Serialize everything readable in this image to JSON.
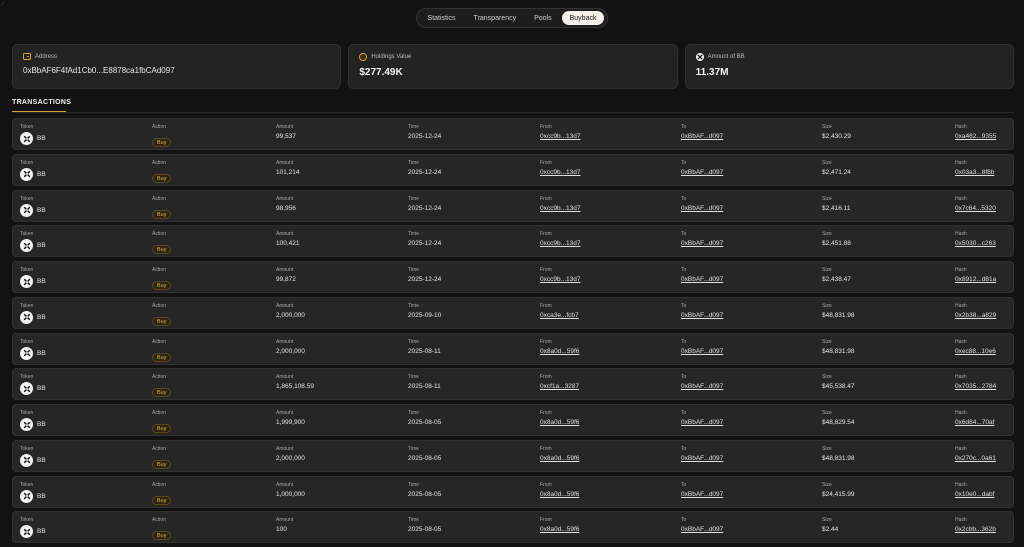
{
  "corner_mark": "⁄",
  "nav": {
    "tabs": [
      {
        "label": "Statistics"
      },
      {
        "label": "Transparency"
      },
      {
        "label": "Pools"
      },
      {
        "label": "Buyback",
        "active": true
      }
    ]
  },
  "cards": {
    "address": {
      "title": "Address",
      "value": "0xBbAF6F4fAd1Cb0...E8878ca1fbCAd097",
      "icon": "wallet-icon"
    },
    "holdings": {
      "title": "Holdings Value",
      "value": "$277.49K",
      "icon": "coins-icon"
    },
    "amount": {
      "title": "Amount of BB",
      "value": "11.37M",
      "icon": "bb-token-icon"
    }
  },
  "transactions": {
    "title": "TRANSACTIONS",
    "labels": {
      "token": "Token",
      "action": "Action",
      "amount": "Amount",
      "time": "Time",
      "from": "From",
      "to": "To",
      "size": "Size",
      "hash": "Hash"
    },
    "rows": [
      {
        "token": "BB",
        "action": "Buy",
        "amount": "99,537",
        "time": "2025-12-24",
        "from": "0xcc9b...13d7",
        "to": "0xBbAF...d097",
        "size": "$2,430.29",
        "hash": "0xa462...9355"
      },
      {
        "token": "BB",
        "action": "Buy",
        "amount": "101,214",
        "time": "2025-12-24",
        "from": "0xcc9b...13d7",
        "to": "0xBbAF...d097",
        "size": "$2,471.24",
        "hash": "0x03a3...8f8b"
      },
      {
        "token": "BB",
        "action": "Buy",
        "amount": "98,956",
        "time": "2025-12-24",
        "from": "0xcc9b...13d7",
        "to": "0xBbAF...d097",
        "size": "$2,416.11",
        "hash": "0x7c64...5320"
      },
      {
        "token": "BB",
        "action": "Buy",
        "amount": "100,421",
        "time": "2025-12-24",
        "from": "0xcc9b...13d7",
        "to": "0xBbAF...d097",
        "size": "$2,451.88",
        "hash": "0x5030...c263"
      },
      {
        "token": "BB",
        "action": "Buy",
        "amount": "99,872",
        "time": "2025-12-24",
        "from": "0xcc9b...13d7",
        "to": "0xBbAF...d097",
        "size": "$2,438.47",
        "hash": "0x8912...d81a"
      },
      {
        "token": "BB",
        "action": "Buy",
        "amount": "2,000,000",
        "time": "2025-09-10",
        "from": "0xca3e...fcb7",
        "to": "0xBbAF...d097",
        "size": "$48,831.98",
        "hash": "0x2b38...a829"
      },
      {
        "token": "BB",
        "action": "Buy",
        "amount": "2,000,000",
        "time": "2025-08-11",
        "from": "0x8a0d...59f6",
        "to": "0xBbAF...d097",
        "size": "$48,831.98",
        "hash": "0xec88...10e6"
      },
      {
        "token": "BB",
        "action": "Buy",
        "amount": "1,865,108.59",
        "time": "2025-08-11",
        "from": "0xcf1a...3287",
        "to": "0xBbAF...d097",
        "size": "$45,538.47",
        "hash": "0x7035...2784"
      },
      {
        "token": "BB",
        "action": "Buy",
        "amount": "1,999,900",
        "time": "2025-08-05",
        "from": "0x8a0d...59f6",
        "to": "0xBbAF...d097",
        "size": "$48,829.54",
        "hash": "0x6d84...70af"
      },
      {
        "token": "BB",
        "action": "Buy",
        "amount": "2,000,000",
        "time": "2025-08-05",
        "from": "0x8a0d...59f6",
        "to": "0xBbAF...d097",
        "size": "$48,831.98",
        "hash": "0x270c...0a61"
      },
      {
        "token": "BB",
        "action": "Buy",
        "amount": "1,000,000",
        "time": "2025-08-05",
        "from": "0x8a0d...59f6",
        "to": "0xBbAF...d097",
        "size": "$24,415.99",
        "hash": "0x10e0...dabf"
      },
      {
        "token": "BB",
        "action": "Buy",
        "amount": "100",
        "time": "2025-08-05",
        "from": "0x8a0d...59f6",
        "to": "0xBbAF...d097",
        "size": "$2.44",
        "hash": "0x2cbb...362b"
      }
    ]
  },
  "colors": {
    "accent": "#d8a335",
    "background": "#121212",
    "card": "#232323",
    "row": "#262626"
  }
}
